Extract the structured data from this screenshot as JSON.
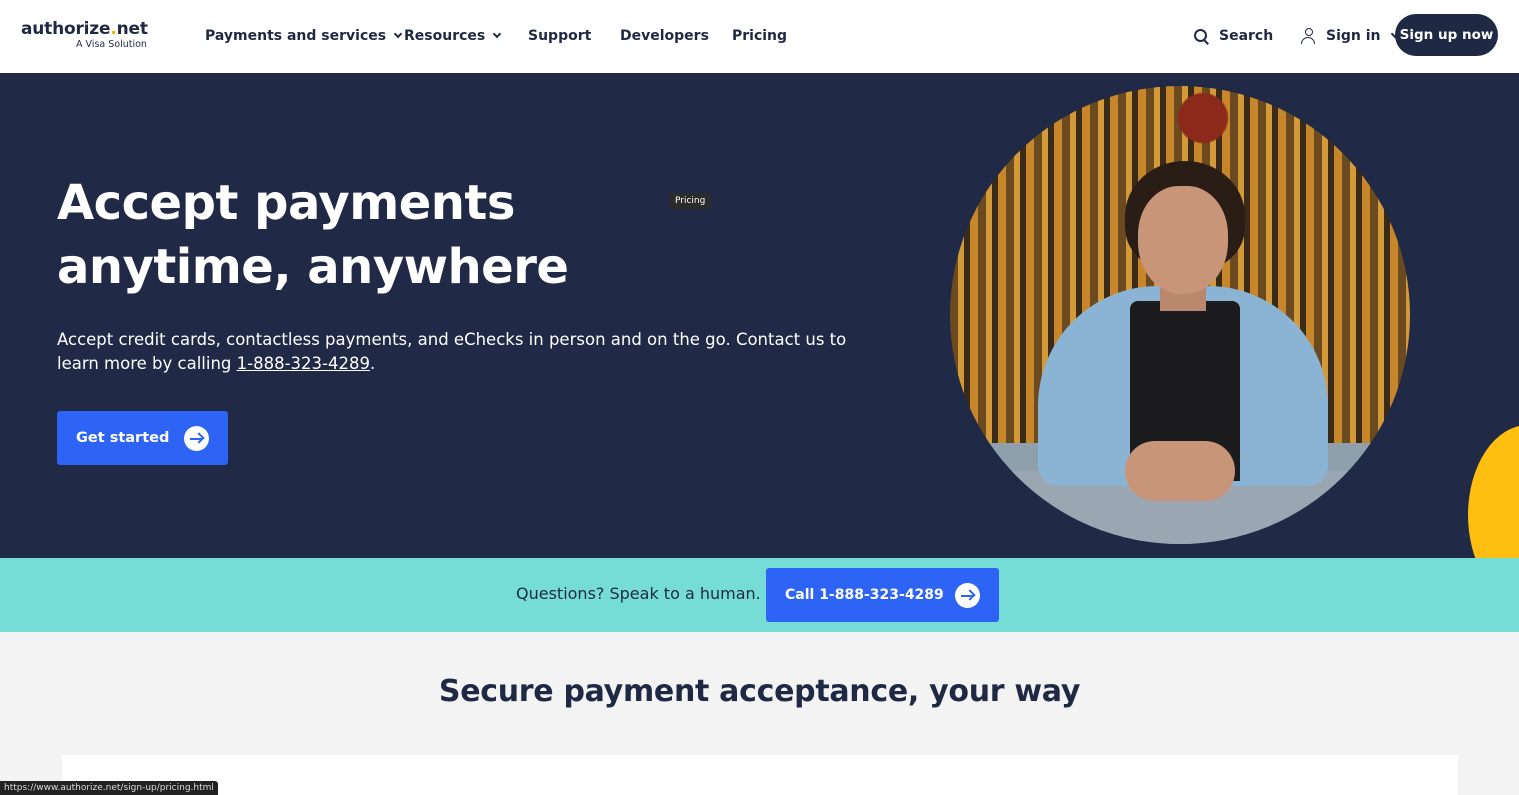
{
  "header": {
    "logo": {
      "name": "authorize",
      "dot": ".",
      "tld": "net",
      "tagline": "A Visa Solution"
    },
    "nav": [
      {
        "label": "Payments and services",
        "has_dropdown": true
      },
      {
        "label": "Resources",
        "has_dropdown": true
      },
      {
        "label": "Support",
        "has_dropdown": false
      },
      {
        "label": "Developers",
        "has_dropdown": false
      },
      {
        "label": "Pricing",
        "has_dropdown": false
      }
    ],
    "search_label": "Search",
    "signin_label": "Sign in",
    "signup_label": "Sign up now"
  },
  "hero": {
    "title": "Accept payments anytime, anywhere",
    "tooltip": "Pricing",
    "description_before": "Accept credit cards, contactless payments, and eChecks in person and on the go. Contact us to learn more by calling ",
    "phone": "1-888-323-4289",
    "description_after": ".",
    "cta_label": "Get started"
  },
  "band": {
    "text": "Questions? Speak to a human.",
    "call_label": "Call 1-888-323-4289"
  },
  "section": {
    "title": "Secure payment acceptance, your way"
  },
  "status_bar": {
    "url": "https://www.authorize.net/sign-up/pricing.html"
  },
  "colors": {
    "navy": "#202945",
    "blue": "#2e64f5",
    "teal": "#75dcd6",
    "yellow": "#ffbf10",
    "logo_dot": "#f5b301"
  },
  "icons": [
    "search-icon",
    "user-icon",
    "chevron-down-icon",
    "arrow-right-circle-icon"
  ]
}
